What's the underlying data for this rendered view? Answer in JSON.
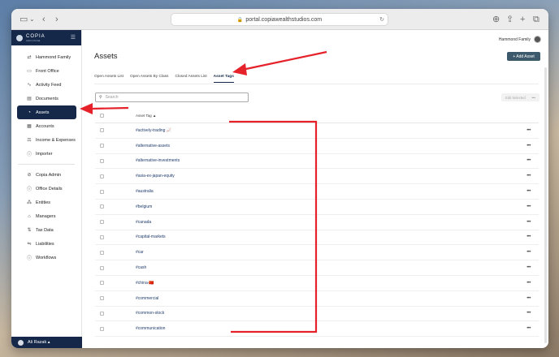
{
  "browser": {
    "url": "portal.copiawealthstudios.com",
    "icons": [
      "sidebar-toggle-icon",
      "back-icon",
      "forward-icon",
      "download-icon",
      "share-icon",
      "new-tab-icon",
      "tabs-icon"
    ]
  },
  "brand": {
    "name": "COPIA",
    "subtitle": "Admin Portal"
  },
  "sidebar": {
    "items": [
      {
        "label": "Hammond Family",
        "icon": "⇄"
      },
      {
        "label": "Front Office",
        "icon": "▭"
      },
      {
        "label": "Activity Feed",
        "icon": "∿"
      },
      {
        "label": "Documents",
        "icon": "▤"
      },
      {
        "label": "Assets",
        "icon": "◔"
      },
      {
        "label": "Accounts",
        "icon": "▦"
      },
      {
        "label": "Income & Expenses",
        "icon": "⚖"
      },
      {
        "label": "Importer",
        "icon": "ⓘ"
      },
      {
        "label": "Copia Admin",
        "icon": "⊘"
      },
      {
        "label": "Office Details",
        "icon": "ⓘ"
      },
      {
        "label": "Entities",
        "icon": "⁂"
      },
      {
        "label": "Managers",
        "icon": "⌂"
      },
      {
        "label": "Tax Data",
        "icon": "⇅"
      },
      {
        "label": "Liabilities",
        "icon": "⇋"
      },
      {
        "label": "Workflows",
        "icon": "ⓘ"
      }
    ],
    "user": "Ali Razak ▴"
  },
  "header": {
    "family": "Hammond Family",
    "title": "Assets",
    "add_button": "+ Add Asset"
  },
  "tabs": [
    "Open Assets List",
    "Open Assets By Class",
    "Closed Assets List",
    "Asset Tags"
  ],
  "search": {
    "placeholder": "Search"
  },
  "edit_selected": "Edit Selected",
  "table": {
    "header": "Asset Tag ▲",
    "rows": [
      "#actively-trading 📈",
      "#alternative-assets",
      "#alternative-investments",
      "#asia-ex-japan-equity",
      "#australia",
      "#belgium",
      "#canada",
      "#capital-markets",
      "#car",
      "#cash",
      "#china-🇨🇳",
      "#commercial",
      "#common-stock",
      "#communication"
    ]
  },
  "colors": {
    "navy": "#152849",
    "button": "#3d5a6c",
    "annotation": "#e5212a"
  }
}
